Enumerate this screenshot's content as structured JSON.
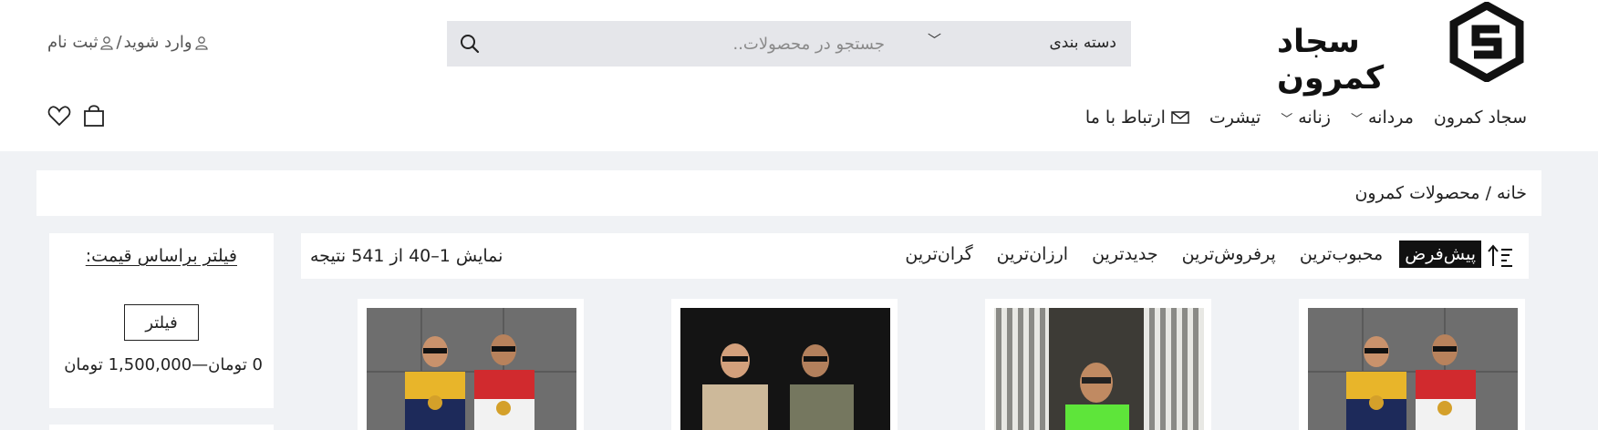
{
  "header": {
    "logo_text": "سجاد کمرون",
    "search": {
      "category_label": "دسته بندی",
      "placeholder": "جستجو در محصولات.."
    },
    "account": {
      "login_label": "وارد شوید",
      "separator": "/",
      "register_label": "ثبت نام"
    }
  },
  "nav": {
    "items": [
      {
        "label": "سجاد کمرون",
        "icon": null,
        "dropdown": false
      },
      {
        "label": "مردانه",
        "icon": "chevron-down-icon",
        "dropdown": true
      },
      {
        "label": "زنانه",
        "icon": "chevron-down-icon",
        "dropdown": true
      },
      {
        "label": "تیشرت",
        "icon": null,
        "dropdown": false
      },
      {
        "label": "ارتباط با ما",
        "icon": "envelope-icon",
        "dropdown": false
      }
    ],
    "icons": [
      "heart-icon",
      "shopping-bag-icon"
    ]
  },
  "breadcrumb": {
    "home": "خانه",
    "separator": "/",
    "current": "محصولات کمرون"
  },
  "sidebar": {
    "title": "فیلتر براساس قیمت:",
    "filter_button": "فیلتر",
    "price_range": "0 تومان—1,500,000 تومان"
  },
  "sortbar": {
    "options": [
      "پیش‌فرض",
      "محبوب‌ترین",
      "پرفروش‌ترین",
      "جدیدترین",
      "ارزان‌ترین",
      "گران‌ترین"
    ],
    "active_index": 0,
    "result_count": "نمایش 1–40 از 541 نتیجه"
  },
  "colors": {
    "page_bg": "#f0f2f5",
    "search_bg": "#e5e6ea",
    "active_sort_bg": "#111111"
  }
}
